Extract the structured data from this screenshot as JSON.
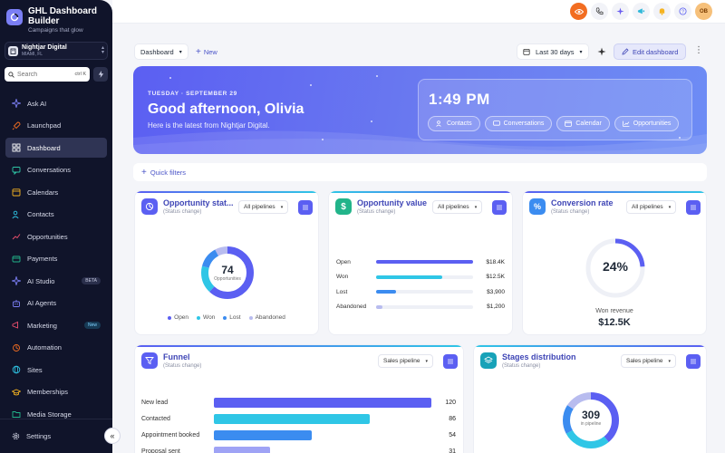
{
  "sidebar": {
    "brand_title": "GHL Dashboard Builder",
    "brand_subtitle": "Campaigns that glow",
    "account_name": "Nightjar Digital",
    "account_location": "MIAMI, FL",
    "search_placeholder": "Search",
    "search_shortcut": "ctrl K",
    "items": [
      {
        "label": "Ask AI",
        "icon": "sparkle-icon"
      },
      {
        "label": "Launchpad",
        "icon": "rocket-icon"
      },
      {
        "label": "Dashboard",
        "icon": "grid-icon",
        "active": true
      },
      {
        "label": "Conversations",
        "icon": "chat-icon"
      },
      {
        "label": "Calendars",
        "icon": "calendar-icon"
      },
      {
        "label": "Contacts",
        "icon": "users-icon"
      },
      {
        "label": "Opportunities",
        "icon": "trend-icon"
      },
      {
        "label": "Payments",
        "icon": "card-icon"
      },
      {
        "label": "AI Studio",
        "icon": "sparkle-icon",
        "badge": "BETA"
      },
      {
        "label": "AI Agents",
        "icon": "bot-icon"
      },
      {
        "label": "Marketing",
        "icon": "megaphone-icon",
        "badge": "New"
      },
      {
        "label": "Automation",
        "icon": "automation-icon"
      },
      {
        "label": "Sites",
        "icon": "globe-icon"
      },
      {
        "label": "Memberships",
        "icon": "grad-cap-icon"
      },
      {
        "label": "Media Storage",
        "icon": "folder-icon"
      }
    ],
    "settings_label": "Settings"
  },
  "topbar": {
    "avatar_initials": "OB"
  },
  "toolbar": {
    "dashboard_label": "Dashboard",
    "new_label": "New",
    "date_range": "Last 30 days",
    "edit_label": "Edit dashboard"
  },
  "hero": {
    "date": "TUESDAY · SEPTEMBER 29",
    "greeting": "Good afternoon, Olivia",
    "subtitle": "Here is the latest from Nightjar Digital.",
    "time": "1:49 PM",
    "chips": [
      "Contacts",
      "Conversations",
      "Calendar",
      "Opportunities"
    ]
  },
  "quick_filters_label": "Quick filters",
  "cards": {
    "opp_status": {
      "title": "Opportunity stat...",
      "subtitle": "(Status change)",
      "select": "All pipelines",
      "total": "74",
      "total_label": "Opportunities",
      "legend": [
        "Open",
        "Won",
        "Lost",
        "Abandoned"
      ]
    },
    "opp_value": {
      "title": "Opportunity value",
      "subtitle": "(Status change)",
      "select": "All pipelines",
      "rows": [
        {
          "label": "Open",
          "value": "$18.4K",
          "frac": 1.0
        },
        {
          "label": "Won",
          "value": "$12.5K",
          "frac": 0.68
        },
        {
          "label": "Lost",
          "value": "$3,900",
          "frac": 0.21
        },
        {
          "label": "Abandoned",
          "value": "$1,200",
          "frac": 0.07
        }
      ]
    },
    "conversion": {
      "title": "Conversion rate",
      "subtitle": "(Status change)",
      "select": "All pipelines",
      "rate": "24%",
      "rate_frac": 0.24,
      "revenue_label": "Won revenue",
      "revenue": "$12.5K"
    },
    "funnel": {
      "title": "Funnel",
      "subtitle": "(Status change)",
      "select": "Sales pipeline",
      "rows": [
        {
          "label": "New lead",
          "value": "120"
        },
        {
          "label": "Contacted",
          "value": "86"
        },
        {
          "label": "Appointment booked",
          "value": "54"
        },
        {
          "label": "Proposal sent",
          "value": "31"
        }
      ]
    },
    "stages": {
      "title": "Stages distribution",
      "subtitle": "(Status change)",
      "select": "Sales pipeline",
      "total": "309",
      "total_label": "in pipeline"
    }
  },
  "colors": {
    "accent": "#5b5ff2",
    "open": "#5b5ff2",
    "won": "#2fc6e6",
    "lost": "#3b8cf0",
    "abandoned": "#b8bcef"
  }
}
